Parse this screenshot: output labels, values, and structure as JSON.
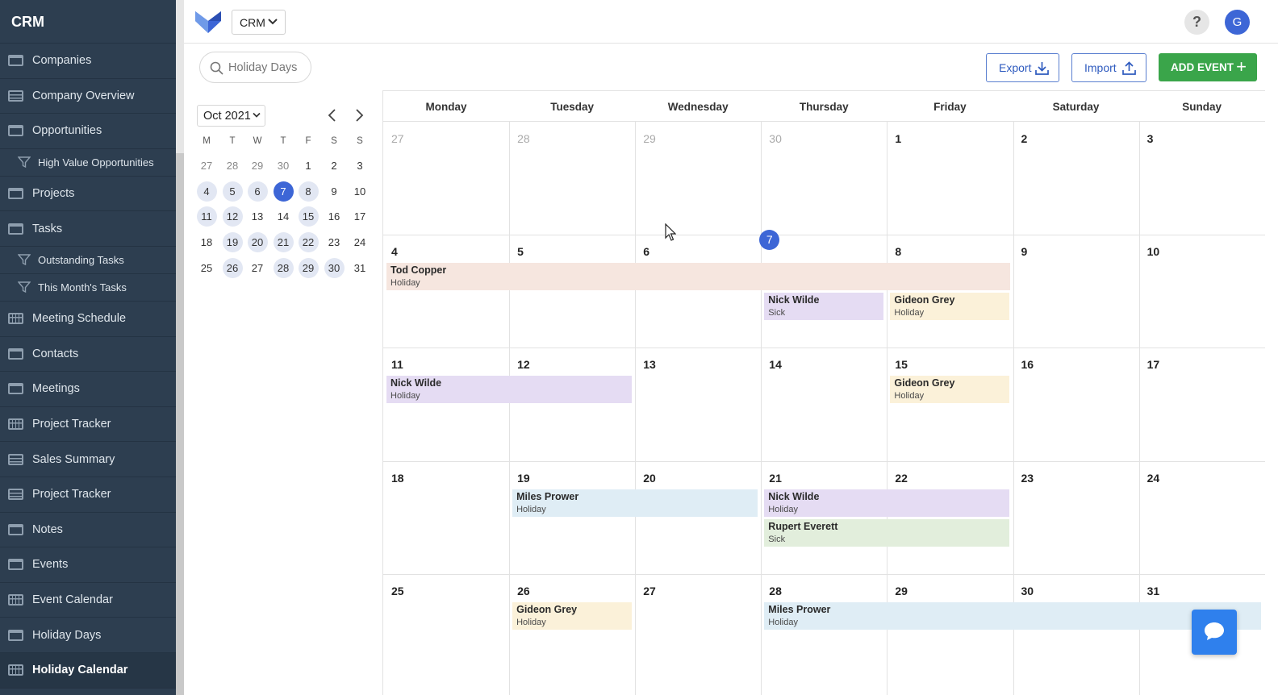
{
  "sidebar": {
    "title": "CRM",
    "items": [
      {
        "label": "Companies",
        "icon": "table-icon",
        "sub": false,
        "active": false
      },
      {
        "label": "Company Overview",
        "icon": "grid-view-icon",
        "sub": false,
        "active": false
      },
      {
        "label": "Opportunities",
        "icon": "table-icon",
        "sub": false,
        "active": false
      },
      {
        "label": "High Value Opportunities",
        "icon": "filter-icon",
        "sub": true,
        "active": false
      },
      {
        "label": "Projects",
        "icon": "table-icon",
        "sub": false,
        "active": false
      },
      {
        "label": "Tasks",
        "icon": "table-icon",
        "sub": false,
        "active": false
      },
      {
        "label": "Outstanding Tasks",
        "icon": "filter-icon",
        "sub": true,
        "active": false
      },
      {
        "label": "This Month's Tasks",
        "icon": "filter-icon",
        "sub": true,
        "active": false
      },
      {
        "label": "Meeting Schedule",
        "icon": "calendar-view-icon",
        "sub": false,
        "active": false
      },
      {
        "label": "Contacts",
        "icon": "table-icon",
        "sub": false,
        "active": false
      },
      {
        "label": "Meetings",
        "icon": "table-icon",
        "sub": false,
        "active": false
      },
      {
        "label": "Project Tracker",
        "icon": "calendar-view-icon",
        "sub": false,
        "active": false
      },
      {
        "label": "Sales Summary",
        "icon": "grid-view-icon",
        "sub": false,
        "active": false
      },
      {
        "label": "Project Tracker",
        "icon": "grid-view-icon",
        "sub": false,
        "active": false
      },
      {
        "label": "Notes",
        "icon": "table-icon",
        "sub": false,
        "active": false
      },
      {
        "label": "Events",
        "icon": "table-icon",
        "sub": false,
        "active": false
      },
      {
        "label": "Event Calendar",
        "icon": "calendar-view-icon",
        "sub": false,
        "active": false
      },
      {
        "label": "Holiday Days",
        "icon": "table-icon",
        "sub": false,
        "active": false
      },
      {
        "label": "Holiday Calendar",
        "icon": "calendar-view-icon",
        "sub": false,
        "active": true
      }
    ]
  },
  "topbar": {
    "app_select": "CRM",
    "help": "?",
    "avatar": "G"
  },
  "toolbar": {
    "search_value": "Holiday Days",
    "export_label": "Export",
    "import_label": "Import",
    "add_label": "ADD EVENT",
    "add_icon": "+"
  },
  "mini_calendar": {
    "month_label": "Oct 2021",
    "weekday_initials": [
      "M",
      "T",
      "W",
      "T",
      "F",
      "S",
      "S"
    ],
    "weeks": [
      [
        "27",
        "28",
        "29",
        "30",
        "1",
        "2",
        "3"
      ],
      [
        "4",
        "5",
        "6",
        "7",
        "8",
        "9",
        "10"
      ],
      [
        "11",
        "12",
        "13",
        "14",
        "15",
        "16",
        "17"
      ],
      [
        "18",
        "19",
        "20",
        "21",
        "22",
        "23",
        "24"
      ],
      [
        "25",
        "26",
        "27",
        "28",
        "29",
        "30",
        "31"
      ]
    ],
    "outside_month": [
      [
        0,
        0
      ],
      [
        0,
        1
      ],
      [
        0,
        2
      ],
      [
        0,
        3
      ]
    ],
    "today": [
      1,
      3
    ],
    "highlighted": [
      [
        1,
        0
      ],
      [
        1,
        1
      ],
      [
        1,
        2
      ],
      [
        1,
        4
      ],
      [
        2,
        0
      ],
      [
        2,
        1
      ],
      [
        2,
        4
      ],
      [
        3,
        1
      ],
      [
        3,
        2
      ],
      [
        3,
        3
      ],
      [
        3,
        4
      ],
      [
        4,
        1
      ],
      [
        4,
        3
      ],
      [
        4,
        4
      ],
      [
        4,
        5
      ]
    ]
  },
  "calendar": {
    "day_names": [
      "Monday",
      "Tuesday",
      "Wednesday",
      "Thursday",
      "Friday",
      "Saturday",
      "Sunday"
    ],
    "weeks": [
      [
        "27",
        "28",
        "29",
        "30",
        "1",
        "2",
        "3"
      ],
      [
        "4",
        "5",
        "6",
        "7",
        "8",
        "9",
        "10"
      ],
      [
        "11",
        "12",
        "13",
        "14",
        "15",
        "16",
        "17"
      ],
      [
        "18",
        "19",
        "20",
        "21",
        "22",
        "23",
        "24"
      ],
      [
        "25",
        "26",
        "27",
        "28",
        "29",
        "30",
        "31"
      ]
    ],
    "outside_month": [
      [
        0,
        0
      ],
      [
        0,
        1
      ],
      [
        0,
        2
      ],
      [
        0,
        3
      ]
    ],
    "today": [
      1,
      3
    ],
    "events": [
      {
        "name": "Tod Copper",
        "type": "Holiday",
        "week": 1,
        "start": 0,
        "span": 5,
        "lane": 0,
        "color": "#f6e6df"
      },
      {
        "name": "Nick Wilde",
        "type": "Sick",
        "week": 1,
        "start": 3,
        "span": 1,
        "lane": 1,
        "color": "#e5dcf3"
      },
      {
        "name": "Gideon Grey",
        "type": "Holiday",
        "week": 1,
        "start": 4,
        "span": 1,
        "lane": 1,
        "color": "#fbf1d9"
      },
      {
        "name": "Nick Wilde",
        "type": "Holiday",
        "week": 2,
        "start": 0,
        "span": 2,
        "lane": 0,
        "color": "#e5dcf3"
      },
      {
        "name": "Gideon Grey",
        "type": "Holiday",
        "week": 2,
        "start": 4,
        "span": 1,
        "lane": 0,
        "color": "#fbf1d9"
      },
      {
        "name": "Miles Prower",
        "type": "Holiday",
        "week": 3,
        "start": 1,
        "span": 2,
        "lane": 0,
        "color": "#dfedf5"
      },
      {
        "name": "Nick Wilde",
        "type": "Holiday",
        "week": 3,
        "start": 3,
        "span": 2,
        "lane": 0,
        "color": "#e5dcf3"
      },
      {
        "name": "Rupert Everett",
        "type": "Sick",
        "week": 3,
        "start": 3,
        "span": 2,
        "lane": 1,
        "color": "#e2eedc"
      },
      {
        "name": "Gideon Grey",
        "type": "Holiday",
        "week": 4,
        "start": 1,
        "span": 1,
        "lane": 0,
        "color": "#fbf1d9"
      },
      {
        "name": "Miles Prower",
        "type": "Holiday",
        "week": 4,
        "start": 3,
        "span": 4,
        "lane": 0,
        "color": "#dfedf5"
      }
    ]
  },
  "colors": {
    "sidebar_bg": "#2d3e50",
    "accent": "#3d66d6",
    "add_button": "#3aa54a",
    "chat_button": "#2f80ed"
  }
}
